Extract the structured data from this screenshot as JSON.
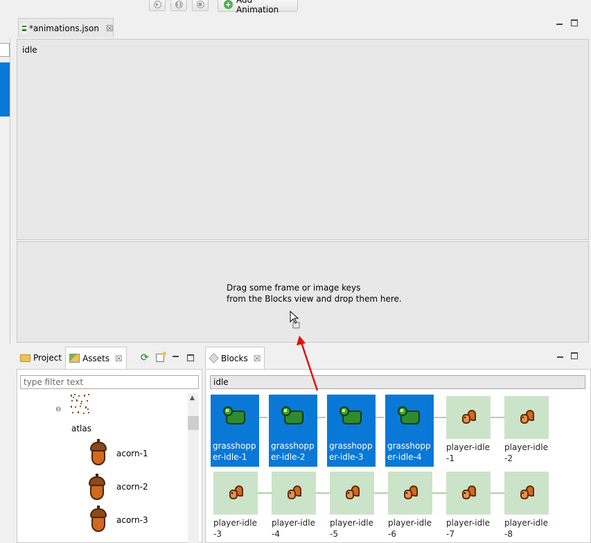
{
  "toolbar": {
    "play_icon": "play-icon",
    "pause_icon": "pause-icon",
    "stop_icon": "stop-icon",
    "add_animation_label": "Add Animation"
  },
  "editor": {
    "tab_title": "*animations.json",
    "animation_name": "idle",
    "drop_message": "Drag some frame or image keys\nfrom the Blocks view and drop them here."
  },
  "assets_panel": {
    "tab_project": "Project",
    "tab_assets": "Assets",
    "filter_placeholder": "type filter text",
    "tree": {
      "atlas_label": "atlas",
      "items": [
        "acorn-1",
        "acorn-2",
        "acorn-3"
      ]
    }
  },
  "blocks_panel": {
    "tab_blocks": "Blocks",
    "filter_value": "idle",
    "row1": [
      {
        "label": "grasshopper-idle-1",
        "selected": true,
        "kind": "grasshopper"
      },
      {
        "label": "grasshopper-idle-2",
        "selected": true,
        "kind": "grasshopper"
      },
      {
        "label": "grasshopper-idle-3",
        "selected": true,
        "kind": "grasshopper"
      },
      {
        "label": "grasshopper-idle-4",
        "selected": true,
        "kind": "grasshopper"
      },
      {
        "label": "player-idle-1",
        "selected": false,
        "kind": "player"
      },
      {
        "label": "player-idle-2",
        "selected": false,
        "kind": "player"
      }
    ],
    "row2": [
      {
        "label": "player-idle-3",
        "selected": false,
        "kind": "player"
      },
      {
        "label": "player-idle-4",
        "selected": false,
        "kind": "player"
      },
      {
        "label": "player-idle-5",
        "selected": false,
        "kind": "player"
      },
      {
        "label": "player-idle-6",
        "selected": false,
        "kind": "player"
      },
      {
        "label": "player-idle-7",
        "selected": false,
        "kind": "player"
      },
      {
        "label": "player-idle-8",
        "selected": false,
        "kind": "player"
      }
    ]
  },
  "colors": {
    "selection_blue": "#0a78d7",
    "block_bg": "#cbe3c8",
    "arrow_red": "#e01010"
  }
}
